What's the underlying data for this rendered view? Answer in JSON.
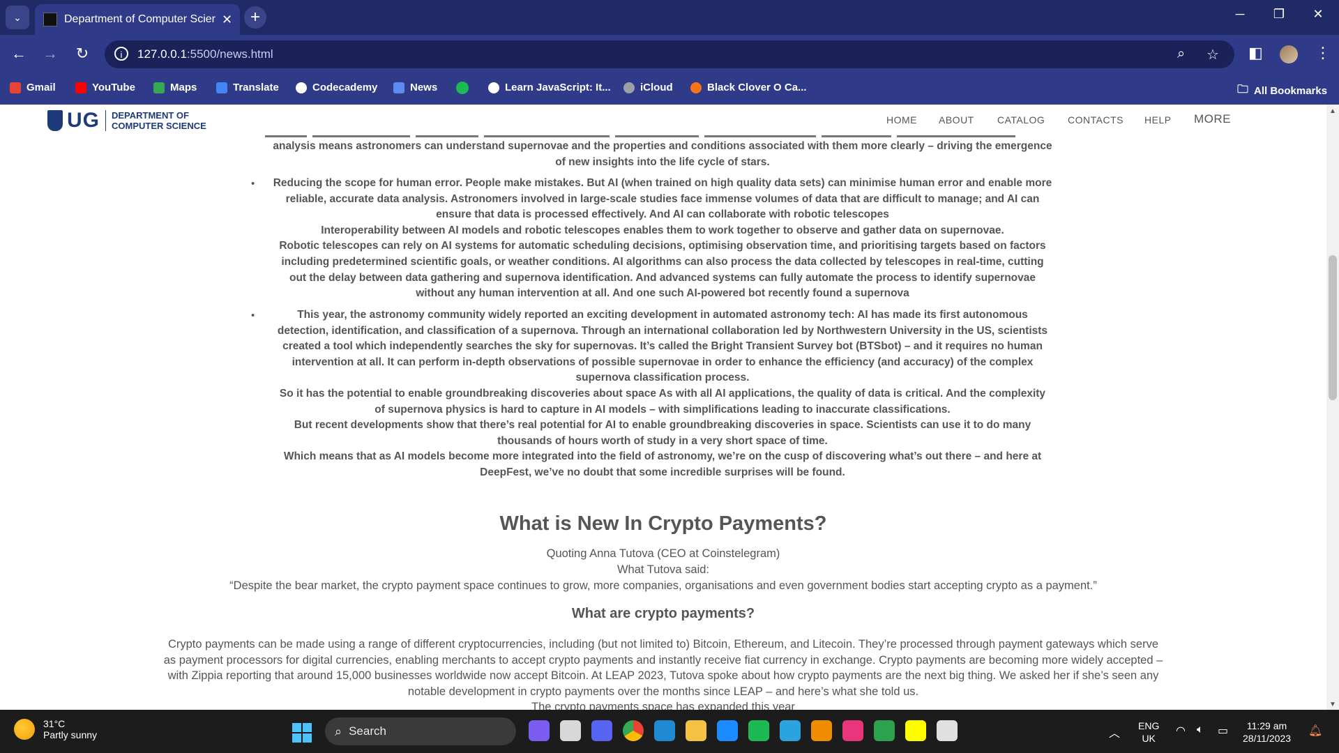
{
  "browser": {
    "tab_title": "Department of Computer Scier",
    "url_host": "127.0.0.1",
    "url_rest": ":5500/news.html",
    "bookmarks": [
      {
        "label": "Gmail",
        "color": "#ea4335"
      },
      {
        "label": "YouTube",
        "color": "#ff0000"
      },
      {
        "label": "Maps",
        "color": "#34a853"
      },
      {
        "label": "Translate",
        "color": "#4285f4"
      },
      {
        "label": "Codecademy",
        "color": "#ffffff"
      },
      {
        "label": "News",
        "color": "#5f8bf0"
      },
      {
        "label": "",
        "color": "#1db954"
      },
      {
        "label": "Learn JavaScript: It...",
        "color": "#ffffff"
      },
      {
        "label": "iCloud",
        "color": "#9aa0a6"
      },
      {
        "label": "Black Clover O Ca...",
        "color": "#f97316"
      }
    ],
    "all_bookmarks": "All Bookmarks"
  },
  "site": {
    "logo_text": "UG",
    "dept_line1": "DEPARTMENT OF",
    "dept_line2": "COMPUTER SCIENCE",
    "menu": [
      "HOME",
      "ABOUT",
      "CATALOG",
      "CONTACTS",
      "HELP",
      "MORE"
    ]
  },
  "article": {
    "top_lines": [
      "analysis means astronomers can understand supernovae and the properties and conditions associated with them more clearly – driving the emergence",
      "of new insights into the life cycle of stars."
    ],
    "bullet2_lines": [
      "Reducing the scope for human error. People make mistakes. But AI (when trained on high quality data sets) can minimise human error and enable more",
      "reliable, accurate data analysis. Astronomers involved in large-scale studies face immense volumes of data that are difficult to manage; and AI can",
      "ensure that data is processed effectively. And AI can collaborate with robotic telescopes",
      "Interoperability between AI models and robotic telescopes enables them to work together to observe and gather data on supernovae.",
      "Robotic telescopes can rely on AI systems for automatic scheduling decisions, optimising observation time, and prioritising targets based on factors",
      "including predetermined scientific goals, or weather conditions. AI algorithms can also process the data collected by telescopes in real-time, cutting",
      "out the delay between data gathering and supernova identification. And advanced systems can fully automate the process to identify supernovae",
      "without any human intervention at all. And one such AI-powered bot recently found a supernova"
    ],
    "bullet3_lines": [
      "This year, the astronomy community widely reported an exciting development in automated astronomy tech: AI has made its first autonomous",
      "detection, identification, and classification of a supernova. Through an international collaboration led by Northwestern University in the US, scientists",
      "created a tool which independently searches the sky for supernovas. It’s called the Bright Transient Survey bot (BTSbot) – and it requires no human",
      "intervention at all. It can perform in-depth observations of possible supernovae in order to enhance the efficiency (and accuracy) of the complex",
      "supernova classification process.",
      "So it has the potential to enable groundbreaking discoveries about space As with all AI applications, the quality of data is critical. And the complexity",
      "of supernova physics is hard to capture in AI models – with simplifications leading to inaccurate classifications.",
      "But recent developments show that there’s real potential for AI to enable groundbreaking discoveries in space. Scientists can use it to do many",
      "thousands of hours worth of study in a very short space of time.",
      "Which means that as AI models become more integrated into the field of astronomy, we’re on the cusp of discovering what’s out there – and here at",
      "DeepFest, we’ve no doubt that some incredible surprises will be found."
    ],
    "crypto_heading": "What is New In Crypto Payments?",
    "quote_by": "Quoting Anna Tutova (CEO at Coinstelegram)",
    "what_said": "What Tutova said:",
    "quote": "“Despite the bear market, the crypto payment space continues to grow, more companies, organisations and even government bodies start accepting crypto as a payment.”",
    "subheading": "What are crypto payments?",
    "crypto_lines": [
      "Crypto payments can be made using a range of different cryptocurrencies, including (but not limited to) Bitcoin, Ethereum, and Litecoin. They’re processed through payment gateways which serve",
      "as payment processors for digital currencies, enabling merchants to accept crypto payments and instantly receive fiat currency in exchange. Crypto payments are becoming more widely accepted –",
      "with Zippia reporting that around 15,000 businesses worldwide now accept Bitcoin. At LEAP 2023, Tutova spoke about how crypto payments are the next big thing. We asked her if she’s seen any",
      "notable development in crypto payments over the months since LEAP – and here’s what she told us."
    ],
    "cut_bottom_line": "The crypto payments space has expanded this year"
  },
  "taskbar": {
    "temp": "31°C",
    "weather": "Partly sunny",
    "search": "Search",
    "lang1": "ENG",
    "lang2": "UK",
    "time": "11:29 am",
    "date": "28/11/2023",
    "apps": [
      {
        "name": "copilot-icon",
        "color": "#7b5cf0"
      },
      {
        "name": "file-stack-icon",
        "color": "#d8d8d8"
      },
      {
        "name": "discord-icon",
        "color": "#5865f2"
      },
      {
        "name": "chrome-icon",
        "color": "#e8453c"
      },
      {
        "name": "vscode-icon",
        "color": "#1f8ad2"
      },
      {
        "name": "file-explorer-icon",
        "color": "#f6c244"
      },
      {
        "name": "app-store-icon",
        "color": "#1a8cff"
      },
      {
        "name": "spotify-icon",
        "color": "#1db954"
      },
      {
        "name": "telegram-icon",
        "color": "#2aa3de"
      },
      {
        "name": "vlc-icon",
        "color": "#f08c00"
      },
      {
        "name": "intellij-icon",
        "color": "#e9357b"
      },
      {
        "name": "git-icon",
        "color": "#2ca24c"
      },
      {
        "name": "snapchat-icon",
        "color": "#fffc00"
      },
      {
        "name": "cursor-icon",
        "color": "#e0e0e0"
      }
    ]
  }
}
